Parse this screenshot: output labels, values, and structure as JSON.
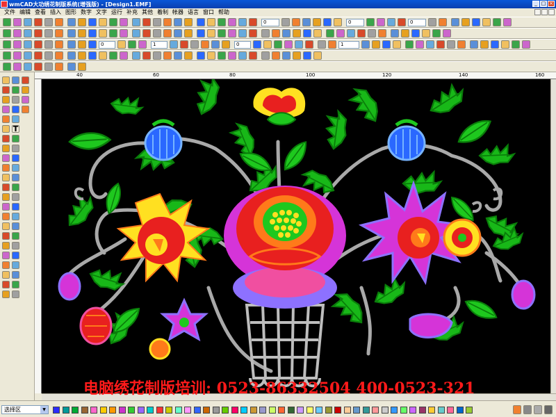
{
  "window": {
    "title": "wmCAD大功绣花制版系统(增强版) - [Design1.EMF]",
    "controls": {
      "minimize": "_",
      "maximize": "□",
      "close": "×"
    }
  },
  "menu": [
    "文件",
    "编辑",
    "查看",
    "插入",
    "图形",
    "数字",
    "文字",
    "运行",
    "补充",
    "其他",
    "着制",
    "帐器",
    "语言",
    "窗口",
    "帮助"
  ],
  "toolbar": {
    "field_1": "0",
    "field_2": "0",
    "field_3": "0",
    "field_4": "0",
    "field_5": "1",
    "field_6": "0",
    "field_7": "1"
  },
  "left_tools": {
    "text_tool": "T"
  },
  "ruler": {
    "top_labels": [
      "40",
      "60",
      "80",
      "100",
      "120",
      "140",
      "160"
    ]
  },
  "status": {
    "layer": "选择区",
    "layer_arrow": "▼"
  },
  "palette": [
    "#2b2bff",
    "#009999",
    "#00aa33",
    "#996633",
    "#ff66cc",
    "#ffcc00",
    "#ff9900",
    "#cc33cc",
    "#33cc33",
    "#9966ff",
    "#00cccc",
    "#ff3333",
    "#cccc00",
    "#66ffcc",
    "#ff99ff",
    "#3366ff",
    "#cc6600",
    "#999999",
    "#66cc00",
    "#ff0066",
    "#00ccff",
    "#cc9933",
    "#9999cc",
    "#ccff66",
    "#ff6633",
    "#336633",
    "#cc99ff",
    "#ffff66",
    "#66ccff",
    "#999933",
    "#cc0000",
    "#ffcc99",
    "#6699cc",
    "#339999",
    "#ff9999",
    "#cccccc",
    "#3399ff",
    "#66ff66",
    "#cc66ff",
    "#993366",
    "#ffcc33",
    "#66cccc",
    "#ff6699",
    "#0066cc",
    "#99cc33"
  ],
  "embroidery": {
    "colors": {
      "leaf": "#1ec81e",
      "leaf_dark": "#0a7d0a",
      "stem": "#a9a9a9",
      "red": "#e8201f",
      "orange": "#ff7a1a",
      "yellow": "#ffe021",
      "magenta": "#d534d8",
      "pink": "#f04fa0",
      "violet": "#8d71ff",
      "blue": "#2a68ff",
      "basket": "#bdbdbd"
    }
  },
  "watermark": "电脑绣花制版培训:  0523-86332504   400-0523-321"
}
